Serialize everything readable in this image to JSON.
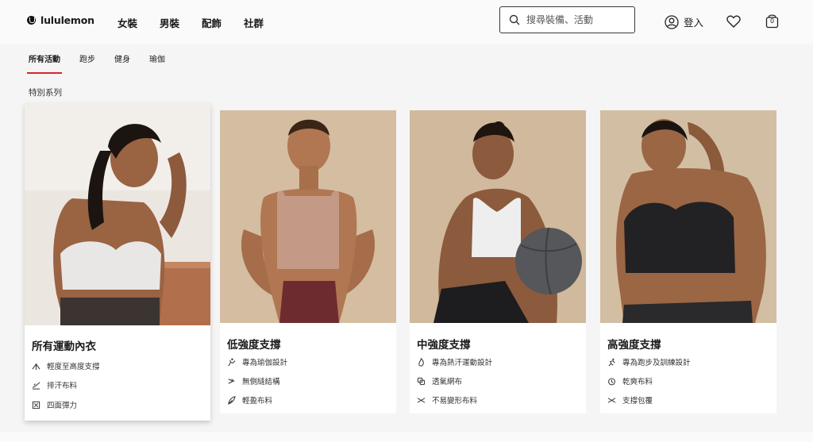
{
  "brand": {
    "name": "lululemon"
  },
  "nav": {
    "items": [
      "女裝",
      "男裝",
      "配飾",
      "社群"
    ]
  },
  "search": {
    "placeholder": "搜尋裝備、活動"
  },
  "account": {
    "login_label": "登入",
    "bag_count": "0"
  },
  "tabs": [
    {
      "label": "所有活動",
      "active": true
    },
    {
      "label": "跑步",
      "active": false
    },
    {
      "label": "健身",
      "active": false
    },
    {
      "label": "瑜伽",
      "active": false
    }
  ],
  "section": {
    "label": "特別系列"
  },
  "cards": [
    {
      "title": "所有運動內衣",
      "features": [
        "輕度至高度支撐",
        "排汗布料",
        "四面彈力"
      ],
      "icons": [
        "support-level-icon",
        "sweat-wicking-icon",
        "four-way-stretch-icon"
      ]
    },
    {
      "title": "低強度支撐",
      "features": [
        "專為瑜伽設計",
        "無側縫結構",
        "輕盈布料"
      ],
      "icons": [
        "yoga-icon",
        "seamless-icon",
        "lightweight-icon"
      ]
    },
    {
      "title": "中強度支撐",
      "features": [
        "專為熱汗運動設計",
        "透氣網布",
        "不易變形布料"
      ],
      "icons": [
        "hot-sweat-icon",
        "breathable-mesh-icon",
        "shape-retention-icon"
      ]
    },
    {
      "title": "高強度支撐",
      "features": [
        "專為跑步及訓練設計",
        "乾爽布料",
        "支撐包覆"
      ],
      "icons": [
        "running-icon",
        "quick-dry-icon",
        "support-wrap-icon"
      ]
    }
  ],
  "colors": {
    "accent": "#d22630",
    "photo_bg1": "#ece6e1",
    "photo_bg2": "#d4bda1",
    "photo_bg3": "#d0b99c",
    "photo_bg4": "#d2bea3"
  }
}
